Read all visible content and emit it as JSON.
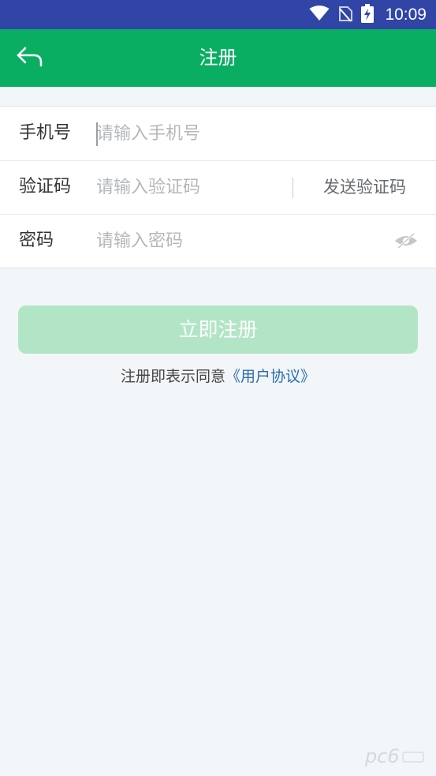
{
  "status_bar": {
    "time": "10:09",
    "icons": [
      "wifi-icon",
      "no-sim-icon",
      "battery-charging-icon"
    ]
  },
  "app_bar": {
    "title": "注册",
    "back_icon": "back-arrow-icon"
  },
  "form": {
    "phone": {
      "label": "手机号",
      "placeholder": "请输入手机号",
      "value": ""
    },
    "code": {
      "label": "验证码",
      "placeholder": "请输入验证码",
      "value": "",
      "send_label": "发送验证码"
    },
    "password": {
      "label": "密码",
      "placeholder": "请输入密码",
      "value": "",
      "toggle_icon": "eye-hidden-icon"
    }
  },
  "register_button": {
    "label": "立即注册"
  },
  "agreement": {
    "prefix": "注册即表示同意",
    "link": "《用户协议》"
  },
  "colors": {
    "status_bar": "#3045a6",
    "app_bar": "#0aae62",
    "button_disabled": "#b2e5c6",
    "link": "#2b6cb0",
    "background": "#f2f6f8"
  }
}
